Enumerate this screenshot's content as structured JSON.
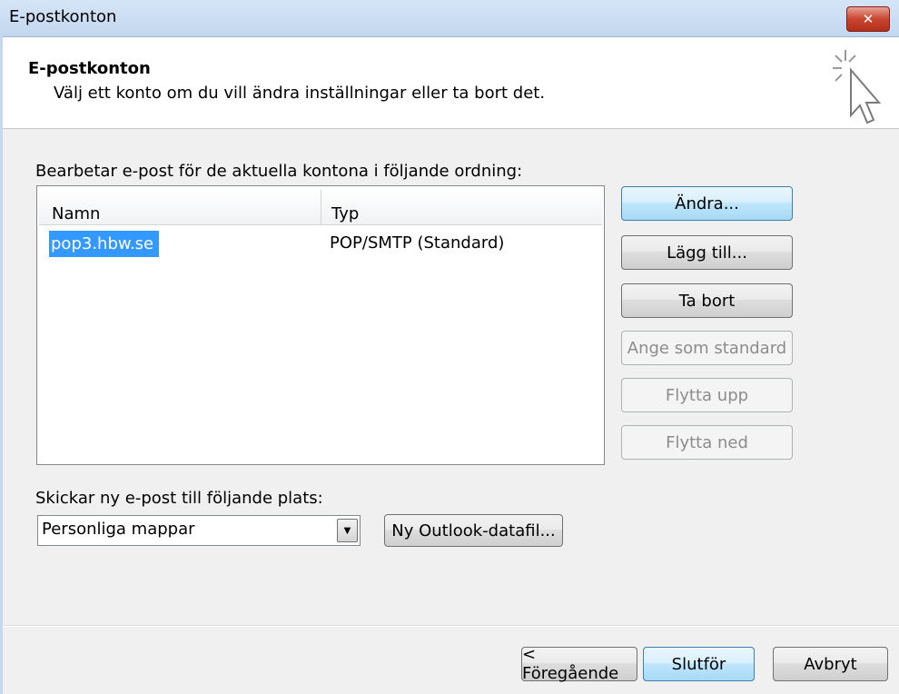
{
  "window": {
    "title": "E-postkonton",
    "close_glyph": "✕"
  },
  "header": {
    "title": "E-postkonton",
    "subtitle": "Välj ett konto om du vill ändra inställningar eller ta bort det.",
    "icon": "cursor-sparkle-icon"
  },
  "accounts": {
    "label": "Bearbetar e-post för de aktuella kontona i följande ordning:",
    "columns": {
      "name": "Namn",
      "type": "Typ"
    },
    "rows": [
      {
        "name": "pop3.hbw.se",
        "type": "POP/SMTP (Standard)",
        "selected": true
      }
    ]
  },
  "side_buttons": {
    "change": "Ändra...",
    "add": "Lägg till...",
    "remove": "Ta bort",
    "set_default": "Ange som standard",
    "move_up": "Flytta upp",
    "move_down": "Flytta ned"
  },
  "delivery": {
    "label": "Skickar ny e-post till följande plats:",
    "selected": "Personliga mappar",
    "new_data_file": "Ny Outlook-datafil..."
  },
  "footer": {
    "back": "< Föregående",
    "finish": "Slutför",
    "cancel": "Avbryt"
  }
}
